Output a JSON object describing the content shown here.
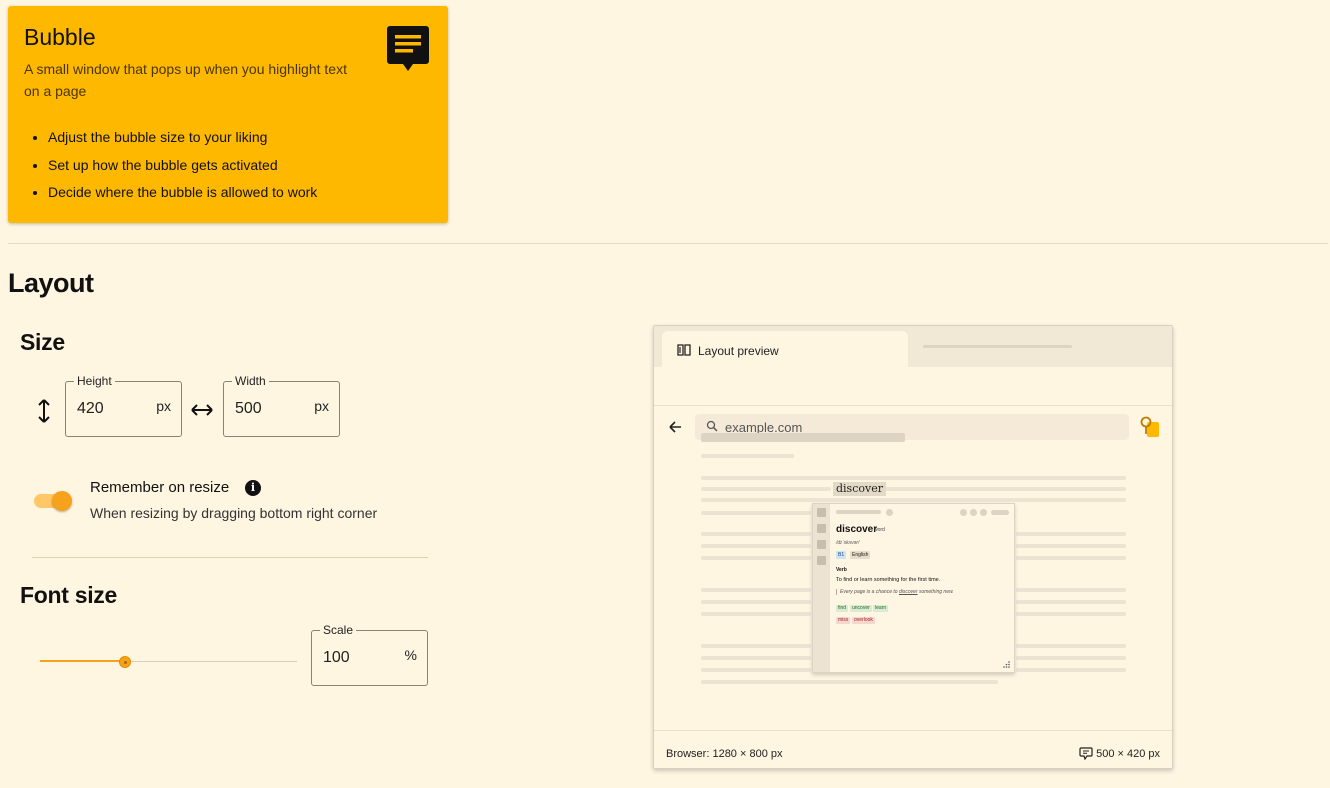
{
  "hero": {
    "title": "Bubble",
    "description": "A small window that pops up when you highlight text on a page",
    "bullets": [
      "Adjust the bubble size to your liking",
      "Set up how the bubble gets activated",
      "Decide where the bubble is allowed to work"
    ],
    "icon": "chat-bubble-lines-icon"
  },
  "layout": {
    "heading": "Layout",
    "size": {
      "heading": "Size",
      "height": {
        "label": "Height",
        "value": "420",
        "unit": "px"
      },
      "width": {
        "label": "Width",
        "value": "500",
        "unit": "px"
      }
    },
    "remember": {
      "title": "Remember on resize",
      "subtitle": "When resizing by dragging bottom right corner",
      "enabled": true
    },
    "font_size": {
      "heading": "Font size",
      "scale": {
        "label": "Scale",
        "value": "100",
        "unit": "%"
      },
      "slider_fraction": 0.33
    }
  },
  "preview": {
    "tab_label": "Layout preview",
    "url": "example.com",
    "highlighted_word": "discover",
    "bubble": {
      "word": "discover",
      "pos": "word",
      "phonetic": "/dɪˈskʌvər/",
      "tags": [
        "B1",
        "English"
      ],
      "verb_label": "Verb",
      "definition": "To find or learn something for the first time.",
      "example_pre": "Every page is a chance to ",
      "example_word": "discover",
      "example_post": " something new.",
      "synonyms": [
        "find",
        "uncover",
        "learn"
      ],
      "antonyms": [
        "miss",
        "overlook"
      ]
    },
    "footer_left": "Browser: 1280 × 800 px",
    "footer_right": "500 × 420 px"
  },
  "colors": {
    "background": "#fff6e2",
    "accent": "#ffb800",
    "toggle": "#f7a21c"
  }
}
